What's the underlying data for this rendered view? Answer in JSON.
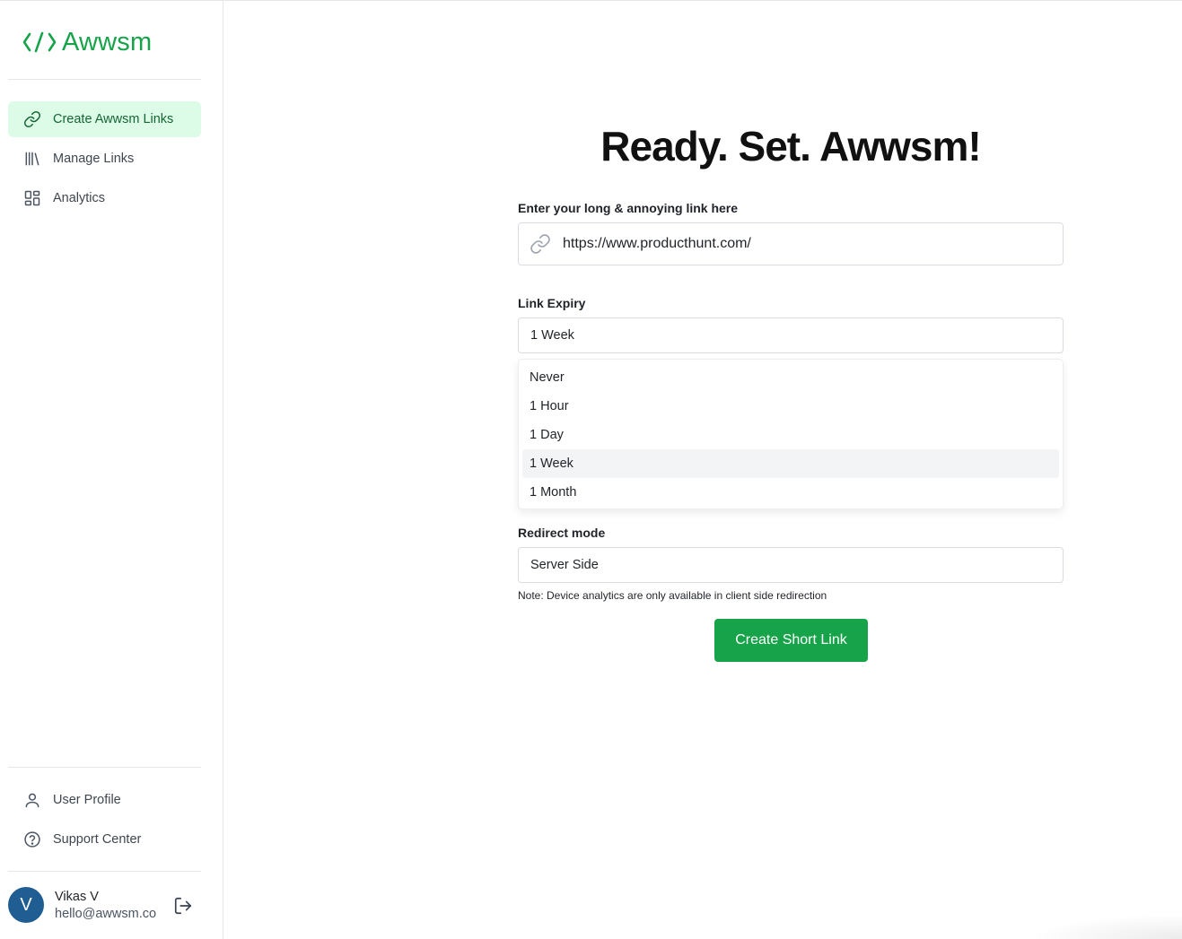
{
  "app": {
    "brand": "Awwsm",
    "accent_color": "#16a34a"
  },
  "sidebar": {
    "nav": [
      {
        "label": "Create Awwsm Links",
        "icon": "link-icon",
        "active": true
      },
      {
        "label": "Manage Links",
        "icon": "library-icon",
        "active": false
      },
      {
        "label": "Analytics",
        "icon": "dashboard-icon",
        "active": false
      }
    ],
    "bottom_nav": [
      {
        "label": "User Profile",
        "icon": "user-icon"
      },
      {
        "label": "Support Center",
        "icon": "help-circle-icon"
      }
    ],
    "user": {
      "initial": "V",
      "name": "Vikas V",
      "email": "hello@awwsm.co"
    }
  },
  "main": {
    "title": "Ready. Set. Awwsm!",
    "url_field": {
      "label": "Enter your long & annoying link here",
      "value": "https://www.producthunt.com/"
    },
    "expiry": {
      "label": "Link Expiry",
      "selected": "1 Week",
      "options": [
        "Never",
        "1 Hour",
        "1 Day",
        "1 Week",
        "1 Month"
      ]
    },
    "redirect": {
      "label": "Redirect mode",
      "selected": "Server Side",
      "note": "Note: Device analytics are only available in client side redirection"
    },
    "submit_label": "Create Short Link"
  }
}
